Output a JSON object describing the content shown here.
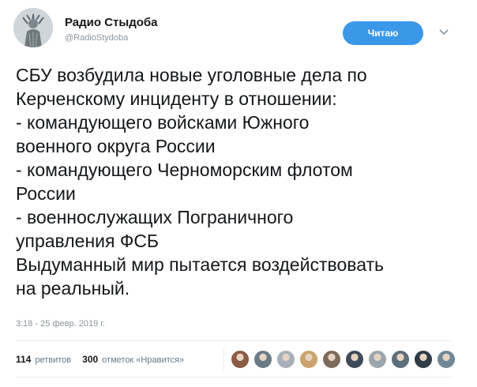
{
  "author": {
    "name": "Радио Стыдоба",
    "handle": "@RadioStydoba",
    "avatar_icon": "statue-of-liberty-avatar-icon"
  },
  "follow_button": {
    "label": "Читаю"
  },
  "menu_icon": "chevron-down-icon",
  "tweet": {
    "text": "СБУ возбудила новые уголовные дела по\nКерченскому инциденту в отношении:\n- командующего войсками Южного\nвоенного округа России\n- командующего Черноморским флотом\nРоссии\n- военнослужащих Пограничного\nуправления ФСБ\nВыдуманный мир пытается воздействовать\nна реальный.",
    "timestamp": "3:18 - 25 февр. 2019 г."
  },
  "stats": {
    "retweets_count": "114",
    "retweets_label": "ретвитов",
    "likes_count": "300",
    "likes_label": "отметок «Нравится»"
  },
  "likers": [
    {
      "icon": "user-avatar-icon",
      "color": "#8a5a44"
    },
    {
      "icon": "user-avatar-icon",
      "color": "#6b7b86"
    },
    {
      "icon": "user-avatar-icon",
      "color": "#a7b0b8"
    },
    {
      "icon": "user-avatar-icon",
      "color": "#c9a36b"
    },
    {
      "icon": "user-avatar-icon",
      "color": "#7d6a5a"
    },
    {
      "icon": "user-avatar-icon",
      "color": "#3d4a57"
    },
    {
      "icon": "user-avatar-icon",
      "color": "#9aa5ad"
    },
    {
      "icon": "user-avatar-icon",
      "color": "#5d6f7b"
    },
    {
      "icon": "user-avatar-icon",
      "color": "#2f3b45"
    },
    {
      "icon": "user-avatar-icon",
      "color": "#6f8796"
    }
  ]
}
